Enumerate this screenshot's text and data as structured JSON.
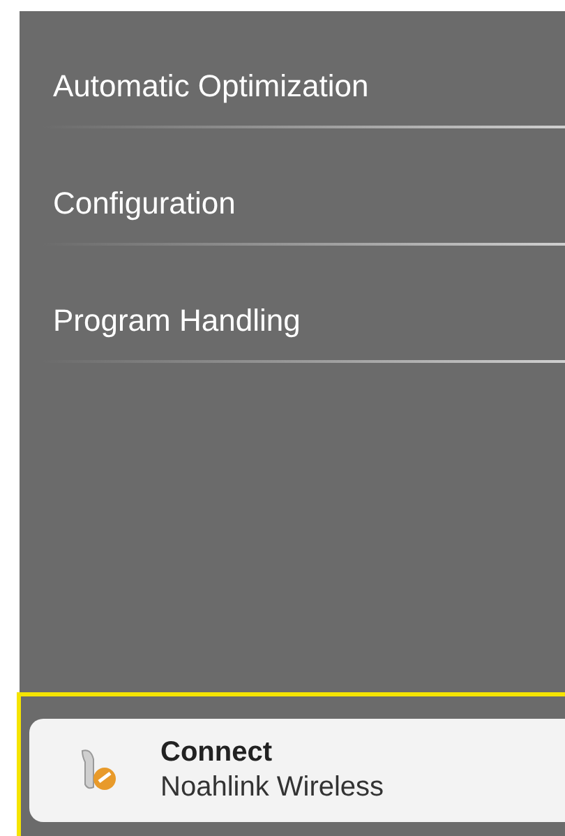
{
  "menu": {
    "items": [
      {
        "label": "Automatic Optimization"
      },
      {
        "label": "Configuration"
      },
      {
        "label": "Program Handling"
      }
    ]
  },
  "connect": {
    "title": "Connect",
    "subtitle": "Noahlink Wireless",
    "highlighted": true
  }
}
